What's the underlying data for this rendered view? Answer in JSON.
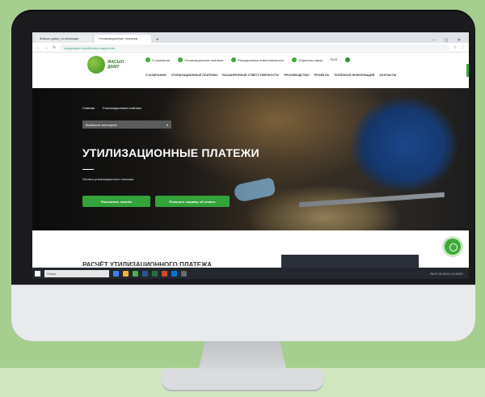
{
  "browser": {
    "tabs": [
      {
        "label": "Жасыл даму | утилизация"
      },
      {
        "label": "Утилизационные платежи"
      }
    ],
    "tab_add": "+",
    "window_controls": "– ▢ ✕",
    "url": "zhasyldamu.kz/utilization-payments"
  },
  "site": {
    "logo_text": "ЖАСЫЛ ДАМУ",
    "contacts": [
      "О компании",
      "Утилизационные платежи",
      "Расширенная ответственность",
      "Обратная связь"
    ],
    "lang": "RUS",
    "nav": [
      "О КОМПАНИИ",
      "УТИЛИЗАЦИОННЫЕ ПЛАТЕЖИ",
      "РАСШИРЕННЫЕ ОТВЕТСТВЕННОСТИ",
      "ПРОИЗВОДСТВО",
      "ПРОЕКТЫ",
      "ПОЛЕЗНАЯ ИНФОРМАЦИЯ",
      "КОНТАКТЫ"
    ]
  },
  "hero": {
    "breadcrumb": [
      "Главная",
      "Утилизационные платежи"
    ],
    "select_label": "Выберите категорию",
    "select_caret": "▾",
    "title": "УТИЛИЗАЦИОННЫЕ ПЛАТЕЖИ",
    "subtitle": "Оплата утилизационного платежа",
    "button_primary": "Рассчитать платёж",
    "button_secondary": "Получить справку об оплате"
  },
  "below": {
    "section_title": "РАСЧЁТ УТИЛИЗАЦИОННОГО ПЛАТЕЖА"
  },
  "taskbar": {
    "search_placeholder": "Поиск",
    "tray": "RUS  14:25  01.10.2021"
  }
}
